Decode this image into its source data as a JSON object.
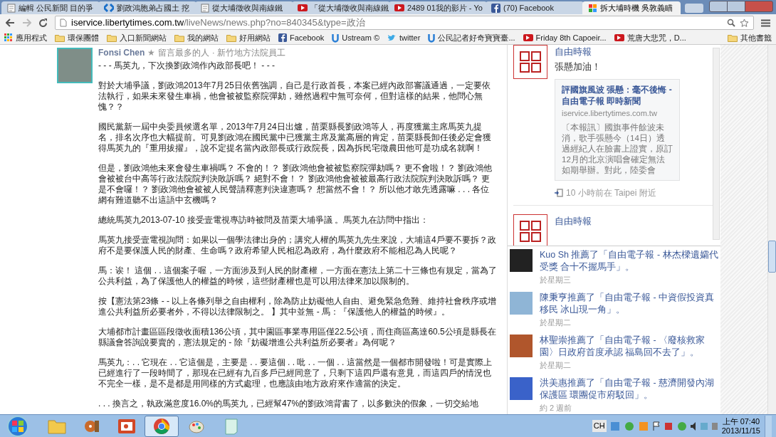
{
  "tabs": [
    {
      "label": "編輯 公民新聞 目的爭",
      "kind": "page",
      "selected": false
    },
    {
      "label": "劉政鴻胞弟占國土 挖",
      "kind": "arrows",
      "selected": false
    },
    {
      "label": "從大埔徵收與南線鐵",
      "kind": "page",
      "selected": false
    },
    {
      "label": "「從大埔徵收與南線鐵",
      "kind": "video",
      "selected": false
    },
    {
      "label": "2489 01我的影片 - Yo",
      "kind": "video",
      "selected": false
    },
    {
      "label": "(70) Facebook",
      "kind": "facebook",
      "selected": false
    },
    {
      "label": "拆大埔時機 吳敦義瞄",
      "kind": "news",
      "selected": true
    }
  ],
  "address": {
    "host": "iservice.libertytimes.com.tw",
    "path": "/liveNews/news.php?no=840345&type=政治"
  },
  "bookmarks": [
    {
      "label": "應用程式",
      "kind": "apps"
    },
    {
      "label": "環保團體",
      "kind": "folder"
    },
    {
      "label": "入口新聞網站",
      "kind": "folder"
    },
    {
      "label": "我的網站",
      "kind": "folder"
    },
    {
      "label": "好用網站",
      "kind": "folder"
    },
    {
      "label": "Facebook",
      "kind": "facebook"
    },
    {
      "label": "Ustream ©",
      "kind": "ustream"
    },
    {
      "label": "twitter",
      "kind": "twitter"
    },
    {
      "label": "公民記者好奇寶寶臺...",
      "kind": "ustream"
    },
    {
      "label": "Friday 8th Capoeir...",
      "kind": "video"
    },
    {
      "label": "荒唐大悲咒，D...",
      "kind": "video"
    }
  ],
  "other_bookmarks": "其他書籤",
  "post": {
    "author": "Fonsi Chen",
    "star": "★",
    "meta": "留言最多的人 · 新竹地方法院員工",
    "paragraphs": [
      "- - - 馬英九，下次換劉政鴻作內政部長吧！ - - -",
      "對於大埔爭議，劉政鴻2013年7月25日依舊強調，自己是行政首長，本案已經內政部審議通過，一定要依法執行，如果未來發生車禍，他會被被監察院彈劾，雖然過程中無可奈何，但對這樣的結果，他問心無愧？？",
      "國民黨新一屆中央委員候選名單，2013年7月24日出爐，苗栗縣長劉政鴻等人，再度獲黨主席馬英九提名，排名次序也大幅提前。可見劉政鴻在國民黨中已獲黨主席及黨高層的肯定，苗栗縣長卸任後必定會獲得馬英九的『重用拔擢』，說不定提名當內政部長或行政院長，因為拆民宅徵農田他可是功成名就啊！",
      "但是，劉政鴻他未來會發生車禍嗎？ 不會的！？ 劉政鴻他會被被監察院彈劾嗎？ 更不會啦！？ 劉政鴻他會被被台中高等行政法院院判決敗訴嗎？ 絕對不會！？ 劉政鴻他會被被最高行政法院院判決敗訴嗎？ 更是不會囉！？ 劉政鴻他會被被人民聲請釋憲判決違憲嗎？ 想當然不會！？ 所以他才敢先透露嘛 . . . 各位網有難道聽不出這語中玄機嗎？",
      "總統馬英九2013-07-10 接受壹電視專訪時被問及苗栗大埔爭議 。馬英九在訪問中指出：",
      "馬英九接受壹電視詢問：如果以一個學法律出身的；講究人權的馬英九先生來說，大埔這4戶要不要拆？政府不是要保護人民的財產、生命嗎？政府希望人民相忍為政府，為什麼政府不能相忍為人民呢？",
      "馬：诶！ 這個 . . 這個案子喔，一方面涉及到人民的財產權，一方面在憲法上第二十三條也有規定，當為了公共利益，為了保護他人的權益的時候，這些財產權也是可以用法律來加以限制的。",
      "按【憲法第23條 - - 以上各條列舉之自由權利，除為防止妨礙他人自由、避免緊急危難、維持社會秩序或增進公共利益所必要者外，不得以法律限制之。 】其中並無 - 馬：『保護他人的權益的時候』。",
      "大埔都市計畫區區段徵收面積136公頃，其中園區事業專用區僅22.5公頃，而住商區高達60.5公頃是縣長在縣議會答詢說要賣的，憲法規定的 - 除『妨礙增進公共利益所必要者』為何呢？",
      "馬英九：. . 它現在 . . 它這個是，主要是 . . 要這個 . . 吡 . . 一個 . . 這當然是一個都市開發啦！可是實際上已經進行了一段時間了，那現在已經有九百多戶已經同意了，只剩下這四戶還有意見，而這四戶的情況也不完全一樣，是不是都是用同樣的方式處理，也應該由地方政府來作適當的決定。",
      ". . . 換言之，執政滿意度16.0%的馬英九，已經幫47%的劉政鴻背書了，以多數決的假象，一切交給地"
    ]
  },
  "page_feed": {
    "posts": [
      {
        "source": "自由時報",
        "text": "張懸加油！",
        "link": {
          "title": "評國旗風波 張懸：毫不後悔 - 自由電子報 即時新聞",
          "domain": "iservice.libertytimes.com.tw",
          "summary": "〔本報訊〕國旗事件餘波未消，歌手張懸今（14日）透過經紀人在臉書上證實，原訂12月的北京演唱會確定無法如期舉辦。對此，陸委會"
        },
        "time": "10 小時前在 Taipei 附近"
      },
      {
        "source": "自由時報"
      }
    ]
  },
  "ticker": [
    {
      "text": "Kuo Sh 推薦了「自由電子報 - 林杰樑遺孀代受獎 合十不握馬手」。",
      "time": "於星期三"
    },
    {
      "text": "陳秉亨推薦了「自由電子報 - 中資假投資真移民 冰山現一角」。",
      "time": "於星期二"
    },
    {
      "text": "林聖崇推薦了「自由電子報 - 〈廢核救家園〉日政府首度承認 福島回不去了」。",
      "time": "於星期二"
    },
    {
      "text": "洪美惠推薦了「自由電子報 - 慈濟開發內湖保護區 環團促市府駁回」。",
      "time": "約 2 週前"
    }
  ],
  "taskbar": {
    "apps": [
      {
        "kind": "folder",
        "selected": false
      },
      {
        "kind": "media",
        "selected": false
      },
      {
        "kind": "slides",
        "selected": false
      },
      {
        "kind": "browser",
        "selected": true
      },
      {
        "kind": "paint",
        "selected": false
      },
      {
        "kind": "notes",
        "selected": false
      }
    ],
    "ime": "CH",
    "time": "上午 07:40",
    "date": "2013/11/15"
  }
}
